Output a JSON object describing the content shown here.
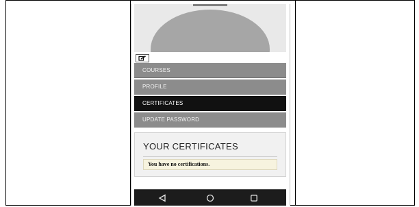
{
  "menu": {
    "items": [
      {
        "label": "COURSES"
      },
      {
        "label": "PROFILE"
      },
      {
        "label": "CERTIFICATES"
      },
      {
        "label": "UPDATE PASSWORD"
      }
    ],
    "active_index": 2
  },
  "certificates": {
    "title": "YOUR CERTIFICATES",
    "empty_message": "You have no certifications."
  },
  "icons": {
    "edit": "edit-icon",
    "back": "back-triangle-icon",
    "home": "home-circle-icon",
    "recent": "recent-apps-square-icon"
  },
  "colors": {
    "menu_bg": "#8c8c8c",
    "menu_active_bg": "#111111",
    "avatar": "#a6a6a6",
    "nav_bar": "#1c1c1c",
    "message_bg": "#f7f3df"
  }
}
